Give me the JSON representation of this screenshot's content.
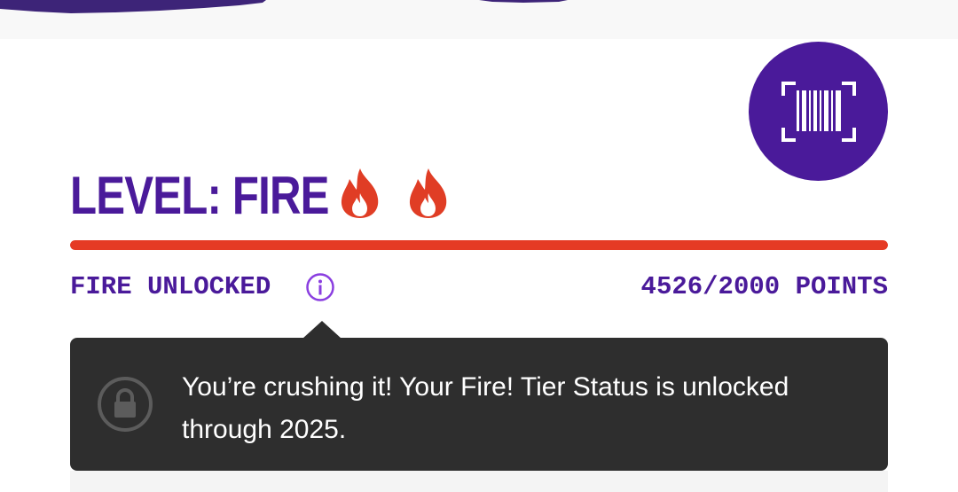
{
  "level": {
    "title": "LEVEL: FIRE",
    "flame_icons": [
      "flame-icon",
      "flame-icon"
    ]
  },
  "scan_button": {
    "icon": "barcode-scan-icon"
  },
  "progress": {
    "fraction": 1.0,
    "status_label": "FIRE UNLOCKED",
    "points_label": "4526/2000 POINTS",
    "info_icon": "info-icon"
  },
  "tooltip": {
    "icon": "lock-icon",
    "message": "You’re crushing it! Your Fire! Tier Status is unlocked through 2025."
  },
  "colors": {
    "brand_purple": "#4a1a9a",
    "accent_red": "#e53a24",
    "tooltip_bg": "#2e2e2e"
  }
}
